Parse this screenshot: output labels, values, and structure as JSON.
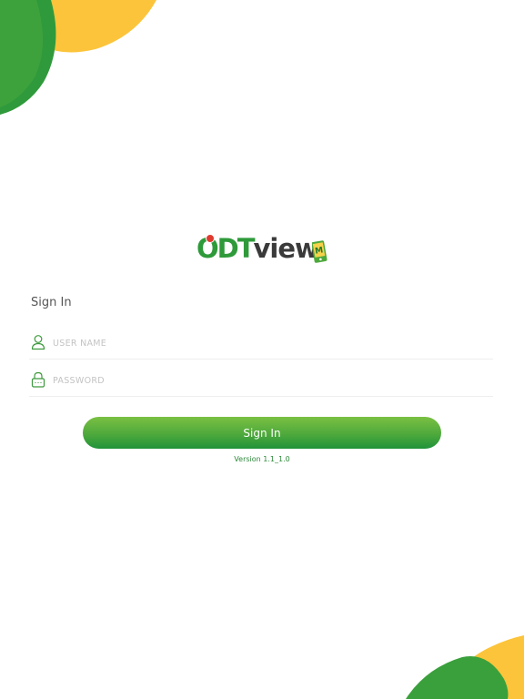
{
  "logo": {
    "brand_left": "ODT",
    "brand_right": "view",
    "badge_letter": "M",
    "brand_green": "#2e9a3a",
    "brand_dark": "#3a3a3a",
    "pin_color": "#e03a2f"
  },
  "form": {
    "heading": "Sign In",
    "username": {
      "placeholder": "USER NAME",
      "value": "",
      "icon": "user-icon"
    },
    "password": {
      "placeholder": "PASSWORD",
      "value": "",
      "icon": "lock-icon"
    },
    "submit_label": "Sign In"
  },
  "footer": {
    "version": "Version 1.1_1.0"
  },
  "colors": {
    "accent_green": "#4ea93c",
    "dark_green": "#1f9339",
    "yellow": "#fcc43a",
    "placeholder_gray": "#c3c3c3"
  }
}
